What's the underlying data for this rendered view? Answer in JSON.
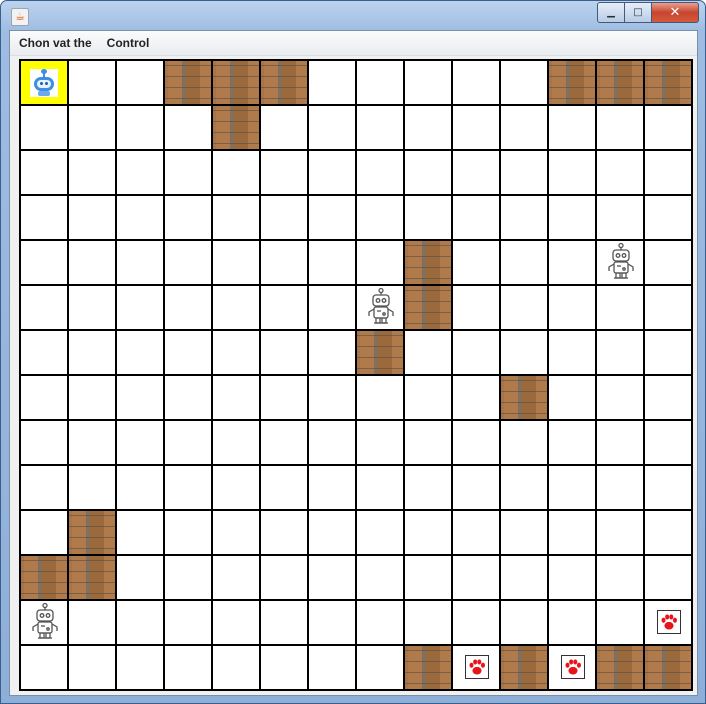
{
  "window": {
    "title": "",
    "icon": "java-icon",
    "controls": {
      "minimize": "▁",
      "maximize": "□",
      "close": "✕"
    }
  },
  "menubar": {
    "items": [
      {
        "label": "Chon vat the"
      },
      {
        "label": "Control"
      }
    ]
  },
  "board": {
    "rows": 14,
    "cols": 14,
    "legend": {
      "empty": "empty-cell",
      "wall": "brick-wall-tile",
      "robot": "robot-icon",
      "avatar": "selected-robot-avatar",
      "paw": "paw-icon"
    },
    "cells": [
      [
        "A",
        ".",
        ".",
        "W",
        "W",
        "W",
        ".",
        ".",
        ".",
        ".",
        ".",
        "W",
        "W",
        "W"
      ],
      [
        ".",
        ".",
        ".",
        ".",
        "W",
        ".",
        ".",
        ".",
        ".",
        ".",
        ".",
        ".",
        ".",
        "."
      ],
      [
        ".",
        ".",
        ".",
        ".",
        ".",
        ".",
        ".",
        ".",
        ".",
        ".",
        ".",
        ".",
        ".",
        "."
      ],
      [
        ".",
        ".",
        ".",
        ".",
        ".",
        ".",
        ".",
        ".",
        ".",
        ".",
        ".",
        ".",
        ".",
        "."
      ],
      [
        ".",
        ".",
        ".",
        ".",
        ".",
        ".",
        ".",
        ".",
        "W",
        ".",
        ".",
        ".",
        "R",
        "."
      ],
      [
        ".",
        ".",
        ".",
        ".",
        ".",
        ".",
        ".",
        "R",
        "W",
        ".",
        ".",
        ".",
        ".",
        "."
      ],
      [
        ".",
        ".",
        ".",
        ".",
        ".",
        ".",
        ".",
        "W",
        ".",
        ".",
        ".",
        ".",
        ".",
        "."
      ],
      [
        ".",
        ".",
        ".",
        ".",
        ".",
        ".",
        ".",
        ".",
        ".",
        ".",
        "W",
        ".",
        ".",
        "."
      ],
      [
        ".",
        ".",
        ".",
        ".",
        ".",
        ".",
        ".",
        ".",
        ".",
        ".",
        ".",
        ".",
        ".",
        "."
      ],
      [
        ".",
        ".",
        ".",
        ".",
        ".",
        ".",
        ".",
        ".",
        ".",
        ".",
        ".",
        ".",
        ".",
        "."
      ],
      [
        ".",
        "W",
        ".",
        ".",
        ".",
        ".",
        ".",
        ".",
        ".",
        ".",
        ".",
        ".",
        ".",
        "."
      ],
      [
        "W",
        "W",
        ".",
        ".",
        ".",
        ".",
        ".",
        ".",
        ".",
        ".",
        ".",
        ".",
        ".",
        "."
      ],
      [
        "R",
        ".",
        ".",
        ".",
        ".",
        ".",
        ".",
        ".",
        ".",
        ".",
        ".",
        ".",
        ".",
        "P"
      ],
      [
        ".",
        ".",
        ".",
        ".",
        ".",
        ".",
        ".",
        ".",
        "W",
        "P",
        "W",
        "P",
        "W",
        "W"
      ]
    ],
    "colors": {
      "selected_cell": "#ffff00",
      "grid_line": "#000000",
      "paw": "#e8141b",
      "avatar": "#3d8ee6"
    }
  }
}
